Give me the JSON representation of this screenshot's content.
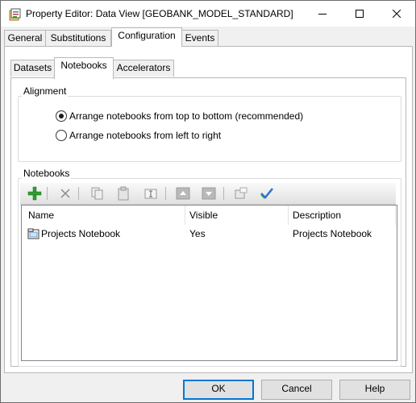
{
  "window": {
    "title": "Property Editor: Data View [GEOBANK_MODEL_STANDARD]"
  },
  "tabs": [
    {
      "label": "General",
      "active": false
    },
    {
      "label": "Substitutions",
      "active": false
    },
    {
      "label": "Configuration",
      "active": true
    },
    {
      "label": "Events",
      "active": false
    }
  ],
  "subtabs": [
    {
      "label": "Datasets",
      "active": false
    },
    {
      "label": "Notebooks",
      "active": true
    },
    {
      "label": "Accelerators",
      "active": false
    }
  ],
  "alignment": {
    "label": "Alignment",
    "options": [
      {
        "label": "Arrange notebooks from top to bottom  (recommended)",
        "selected": true
      },
      {
        "label": "Arrange notebooks from left to right",
        "selected": false
      }
    ]
  },
  "notebooks": {
    "label": "Notebooks",
    "toolbar": [
      "add-icon",
      "delete-icon",
      "copy-icon",
      "paste-icon",
      "rename-icon",
      "move-up-icon",
      "move-down-icon",
      "properties-icon",
      "validate-icon"
    ],
    "columns": [
      "Name",
      "Visible",
      "Description"
    ],
    "rows": [
      {
        "name": "Projects Notebook",
        "visible": "Yes",
        "description": "Projects Notebook"
      }
    ]
  },
  "buttons": {
    "ok": "OK",
    "cancel": "Cancel",
    "help": "Help"
  }
}
